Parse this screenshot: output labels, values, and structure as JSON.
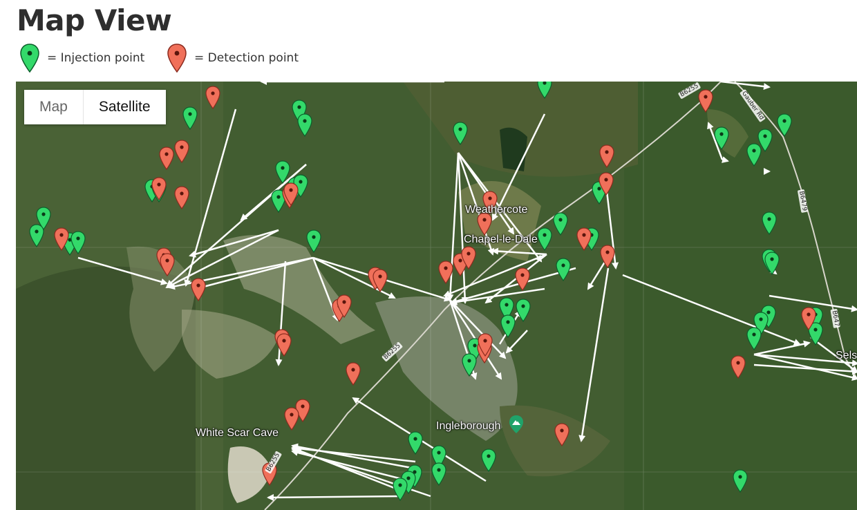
{
  "page": {
    "title": "Map View"
  },
  "legend": {
    "injection": {
      "label": "= Injection point",
      "color": "#33d96a",
      "icon": "green-map-marker-icon"
    },
    "detection": {
      "label": "= Detection point",
      "color": "#f0705a",
      "icon": "red-map-marker-icon"
    }
  },
  "map_type": {
    "options": [
      "Map",
      "Satellite"
    ],
    "selected": "Satellite"
  },
  "places": {
    "white_scar_cave": "White Scar Cave",
    "ingleborough": "Ingleborough",
    "chapel_le_dale": "Chapel-le-Dale",
    "weathercote": "Weathercote",
    "selside": "Sels"
  },
  "roads": {
    "b6255": "B6255",
    "b6255b": "B6255",
    "b6255c": "B6255",
    "b6479": "B6479",
    "b6479b": "B647",
    "gauber": "Gauber Rd"
  },
  "colors": {
    "arrow": "#ffffff",
    "grass": "#3f5a2f",
    "limestone": "#c9c8b4"
  }
}
